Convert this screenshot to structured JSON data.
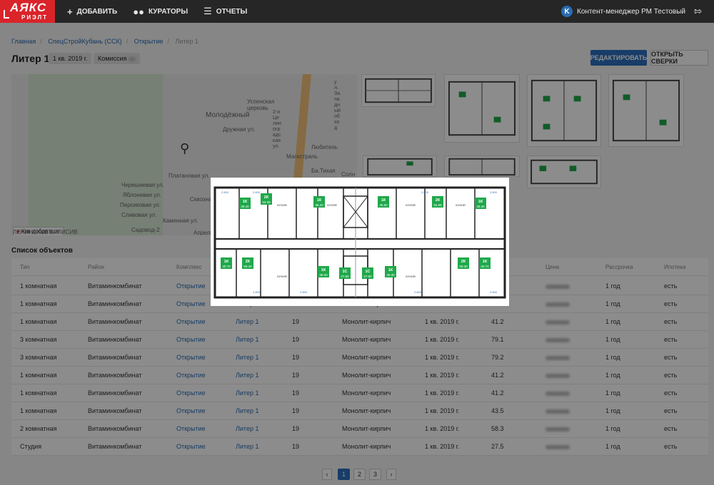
{
  "header": {
    "logo": "АЯКС",
    "logo_sub": "РИЭЛТ",
    "nav": [
      {
        "label": "ДОБАВИТЬ",
        "icon": "plus-icon"
      },
      {
        "label": "КУРАТОРЫ",
        "icon": "users-icon"
      },
      {
        "label": "ОТЧЕТЫ",
        "icon": "list-icon"
      }
    ],
    "user_initial": "K",
    "user_name": "Контент-менеджер РМ Тестовый"
  },
  "breadcrumbs": [
    "Главная",
    "СпецСтройКубань (ССК)",
    "Открытие",
    "Литер 1"
  ],
  "page": {
    "title": "Литер 1",
    "chip_quarter": "1 кв. 2019 г.",
    "chip_commission": "Комиссия",
    "edit_button": "РЕДАКТИРОВАТЬ",
    "open_button": "ОТКРЫТЬ СВЕРКИ"
  },
  "map": {
    "labels": [
      "Молодёжный",
      "Успенская церковь",
      "Дружная ул.",
      "Магистраль",
      "Любитель",
      "Ба.Тихая",
      "Солн",
      "Платановая ул.",
      "Черешневая ул.",
      "Яблоневая ул.",
      "Персиковая ул.",
      "Сливовая ул.",
      "Каменная ул.",
      "Садовод-2",
      "Сквозная",
      "Апрель",
      "ул. Западный обход",
      "2-я Целиноградская ул."
    ],
    "route_label": "Как добраться",
    "footer_text": "ЛЕНИНСКИЕ ВИЛИСИВ"
  },
  "list": {
    "title": "Список объектов",
    "columns": [
      "Тип",
      "Район",
      "Комплекс",
      "",
      "",
      "",
      "",
      "",
      "Цена",
      "Рассрочка",
      "Ипотека"
    ],
    "rows": [
      {
        "type": "1 комнатная",
        "district": "Витаминкомбинат",
        "complex": "Открытие",
        "liter": "",
        "floor": "",
        "material": "",
        "quarter": "",
        "area": "",
        "installment": "1 год",
        "mortgage": "есть"
      },
      {
        "type": "1 комнатная",
        "district": "Витаминкомбинат",
        "complex": "Открытие",
        "liter": "Литер 1",
        "floor": "19",
        "material": "Монолит-кирпич",
        "quarter": "1 кв. 2019 г.",
        "area": "41.2",
        "installment": "1 год",
        "mortgage": "есть"
      },
      {
        "type": "1 комнатная",
        "district": "Витаминкомбинат",
        "complex": "Открытие",
        "liter": "Литер 1",
        "floor": "19",
        "material": "Монолит-кирпич",
        "quarter": "1 кв. 2019 г.",
        "area": "41.2",
        "installment": "1 год",
        "mortgage": "есть"
      },
      {
        "type": "3 комнатная",
        "district": "Витаминкомбинат",
        "complex": "Открытие",
        "liter": "Литер 1",
        "floor": "19",
        "material": "Монолит-кирпич",
        "quarter": "1 кв. 2019 г.",
        "area": "79.1",
        "installment": "1 год",
        "mortgage": "есть"
      },
      {
        "type": "3 комнатная",
        "district": "Витаминкомбинат",
        "complex": "Открытие",
        "liter": "Литер 1",
        "floor": "19",
        "material": "Монолит-кирпич",
        "quarter": "1 кв. 2019 г.",
        "area": "79.2",
        "installment": "1 год",
        "mortgage": "есть"
      },
      {
        "type": "1 комнатная",
        "district": "Витаминкомбинат",
        "complex": "Открытие",
        "liter": "Литер 1",
        "floor": "19",
        "material": "Монолит-кирпич",
        "quarter": "1 кв. 2019 г.",
        "area": "41.2",
        "installment": "1 год",
        "mortgage": "есть"
      },
      {
        "type": "1 комнатная",
        "district": "Витаминкомбинат",
        "complex": "Открытие",
        "liter": "Литер 1",
        "floor": "19",
        "material": "Монолит-кирпич",
        "quarter": "1 кв. 2019 г.",
        "area": "41.2",
        "installment": "1 год",
        "mortgage": "есть"
      },
      {
        "type": "1 комнатная",
        "district": "Витаминкомбинат",
        "complex": "Открытие",
        "liter": "Литер 1",
        "floor": "19",
        "material": "Монолит-кирпич",
        "quarter": "1 кв. 2019 г.",
        "area": "43.5",
        "installment": "1 год",
        "mortgage": "есть"
      },
      {
        "type": "2 комнатная",
        "district": "Витаминкомбинат",
        "complex": "Открытие",
        "liter": "Литер 1",
        "floor": "19",
        "material": "Монолит-кирпич",
        "quarter": "1 кв. 2019 г.",
        "area": "58.3",
        "installment": "1 год",
        "mortgage": "есть"
      },
      {
        "type": "Студия",
        "district": "Витаминкомбинат",
        "complex": "Открытие",
        "liter": "Литер 1",
        "floor": "19",
        "material": "Монолит-кирпич",
        "quarter": "1 кв. 2019 г.",
        "area": "27.5",
        "installment": "1 год",
        "mortgage": "есть"
      }
    ]
  },
  "pagination": {
    "prev": "‹",
    "pages": [
      "1",
      "2",
      "3"
    ],
    "next": "›",
    "active": "1"
  },
  "floorplan": {
    "apartments_top": [
      {
        "kind": "1К",
        "area": "38.40"
      },
      {
        "kind": "2К",
        "area": "52.09"
      },
      {
        "kind": "1К",
        "area": "35.20"
      },
      {
        "kind": "1К",
        "area": "35.82"
      },
      {
        "kind": "2К",
        "area": "52.08"
      },
      {
        "kind": "1К",
        "area": "38.40"
      }
    ],
    "apartments_bottom": [
      {
        "kind": "1К",
        "area": "40.70"
      },
      {
        "kind": "2К",
        "area": "59.40"
      },
      {
        "kind": "1К",
        "area": "39.30"
      },
      {
        "kind": "1С",
        "area": "27.60"
      },
      {
        "kind": "1С",
        "area": "27.60"
      },
      {
        "kind": "1К",
        "area": "39.30"
      },
      {
        "kind": "2К",
        "area": "59.40"
      },
      {
        "kind": "1К",
        "area": "40.70"
      }
    ],
    "room_label": "КУХНЯ",
    "dim_label": "2.600"
  },
  "colors": {
    "brand": "#d9242a",
    "primary": "#2c6fbd",
    "apt_green": "#1fa84a"
  }
}
